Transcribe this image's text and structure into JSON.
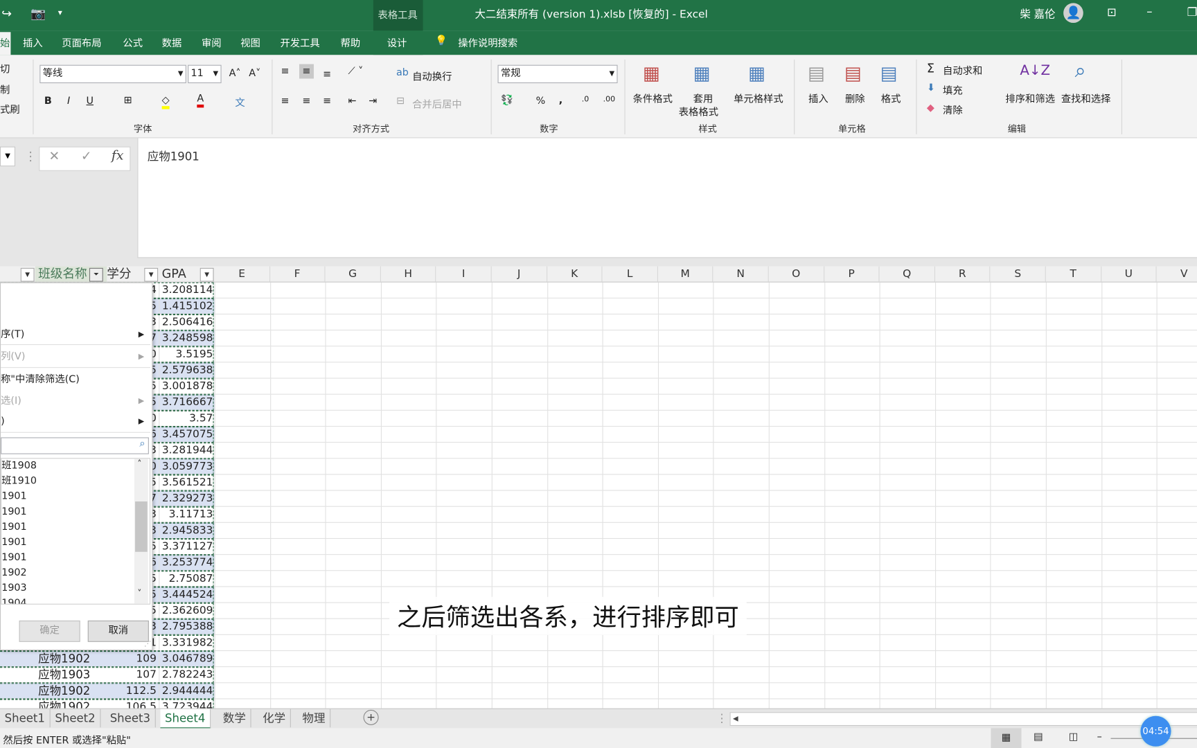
{
  "window": {
    "title": "大二结束所有 (version 1).xlsb [恢复的]  -  Excel",
    "context_tab": "表格工具",
    "user": "柴 嘉伦"
  },
  "tabs": [
    "始",
    "插入",
    "页面布局",
    "公式",
    "数据",
    "审阅",
    "视图",
    "开发工具",
    "帮助",
    "设计"
  ],
  "tell_me": "操作说明搜索",
  "ribbon": {
    "clipboard": [
      "切",
      "制",
      "式刷"
    ],
    "font": {
      "name": "等线",
      "size": "11",
      "group": "字体"
    },
    "align": {
      "wrap": "自动换行",
      "merge": "合并后居中",
      "group": "对齐方式"
    },
    "number": {
      "format": "常规",
      "group": "数字"
    },
    "styles": {
      "cond": "条件格式",
      "table1": "套用",
      "table2": "表格格式",
      "cell": "单元格样式",
      "group": "样式"
    },
    "cells": {
      "insert": "插入",
      "delete": "删除",
      "format": "格式",
      "group": "单元格"
    },
    "edit": {
      "autosum": "自动求和",
      "fill": "填充",
      "clear": "清除",
      "sort": "排序和筛选",
      "find": "查找和选择",
      "group": "编辑"
    }
  },
  "formula_bar": {
    "value": "应物1901"
  },
  "headers": {
    "b": "班级名称",
    "c": "学分",
    "d": "GPA"
  },
  "columns": [
    "E",
    "F",
    "G",
    "H",
    "I",
    "J",
    "K",
    "L",
    "M",
    "N",
    "O",
    "P",
    "Q",
    "R",
    "S",
    "T",
    "U",
    "V"
  ],
  "rows": [
    {
      "name": "",
      "credit": "4",
      "gpa": "3.208114"
    },
    {
      "name": "",
      "credit": "5",
      "gpa": "1.415102"
    },
    {
      "name": "",
      "credit": "3",
      "gpa": "2.506416"
    },
    {
      "name": "",
      "credit": "7",
      "gpa": "3.248598"
    },
    {
      "name": "",
      "credit": "0",
      "gpa": "3.5195"
    },
    {
      "name": "",
      "credit": "5",
      "gpa": "2.579638"
    },
    {
      "name": "",
      "credit": "5",
      "gpa": "3.001878"
    },
    {
      "name": "",
      "credit": "5",
      "gpa": "3.716667"
    },
    {
      "name": "",
      "credit": "0",
      "gpa": "3.57"
    },
    {
      "name": "",
      "credit": "6",
      "gpa": "3.457075"
    },
    {
      "name": "",
      "credit": "3",
      "gpa": "3.281944"
    },
    {
      "name": "",
      "credit": "0",
      "gpa": "3.059773"
    },
    {
      "name": "",
      "credit": "5",
      "gpa": "3.561521"
    },
    {
      "name": "",
      "credit": "7",
      "gpa": "2.329273"
    },
    {
      "name": "",
      "credit": "3",
      "gpa": "3.11713"
    },
    {
      "name": "",
      "credit": "3",
      "gpa": "2.945833"
    },
    {
      "name": "",
      "credit": "5",
      "gpa": "3.371127"
    },
    {
      "name": "",
      "credit": "6",
      "gpa": "3.253774"
    },
    {
      "name": "",
      "credit": "5",
      "gpa": "2.75087"
    },
    {
      "name": "",
      "credit": "5",
      "gpa": "3.444524"
    },
    {
      "name": "",
      "credit": "5",
      "gpa": "2.362609"
    },
    {
      "name": "",
      "credit": "3",
      "gpa": "2.795388"
    },
    {
      "name": "",
      "credit": "1",
      "gpa": "3.331982"
    },
    {
      "name": "应物1902",
      "credit": "109",
      "gpa": "3.046789"
    },
    {
      "name": "应物1903",
      "credit": "107",
      "gpa": "2.782243"
    },
    {
      "name": "应物1902",
      "credit": "112.5",
      "gpa": "2.944444"
    },
    {
      "name": "应物1902",
      "credit": "106.5",
      "gpa": "3.723944"
    }
  ],
  "filter_menu": {
    "items": [
      {
        "label": "序(T)",
        "disabled": false
      },
      {
        "label": "列(V)",
        "disabled": true
      },
      {
        "label": "称\"中清除筛选(C)",
        "disabled": false
      },
      {
        "label": "选(I)",
        "disabled": true
      },
      {
        "label": ")",
        "disabled": false
      }
    ],
    "list": [
      "班1908",
      "班1910",
      "1901",
      "1901",
      "1901",
      "1901",
      "1901",
      "1902",
      "1903",
      "1904"
    ],
    "ok": "确定",
    "cancel": "取消"
  },
  "caption": "之后筛选出各系，进行排序即可",
  "sheets": [
    "Sheet1",
    "Sheet2",
    "Sheet3",
    "Sheet4",
    "数学",
    "化学",
    "物理"
  ],
  "active_sheet": "Sheet4",
  "status": {
    "text": "然后按 ENTER 或选择\"粘贴\"",
    "timer": "04:54"
  },
  "colors": {
    "brand": "#217346",
    "band": "#d9e1f2"
  }
}
